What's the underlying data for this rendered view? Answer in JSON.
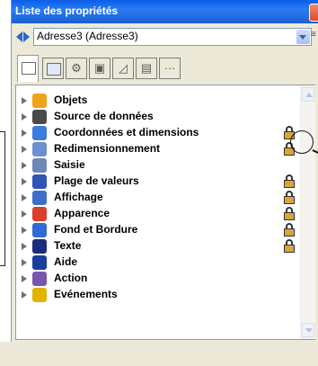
{
  "window": {
    "title": "Liste des propriétés"
  },
  "selector": {
    "value": "Adresse3 (Adresse3)"
  },
  "tabs": [
    {
      "name": "tab-list-icon"
    },
    {
      "name": "tab-form-icon"
    },
    {
      "name": "tab-gear-icon"
    },
    {
      "name": "tab-layout-icon"
    },
    {
      "name": "tab-chart-icon"
    },
    {
      "name": "tab-screen-icon"
    },
    {
      "name": "tab-more-icon"
    }
  ],
  "properties": [
    {
      "label": "Objets",
      "icon": "cube-icon",
      "color": "#f0a21a",
      "locked": false
    },
    {
      "label": "Source de données",
      "icon": "database-icon",
      "color": "#4a4a4a",
      "locked": false
    },
    {
      "label": "Coordonnées et dimensions",
      "icon": "move-icon",
      "color": "#3b7be0",
      "locked": true
    },
    {
      "label": "Redimensionnement",
      "icon": "resize-icon",
      "color": "#6b8fd0",
      "locked": true
    },
    {
      "label": "Saisie",
      "icon": "keyboard-icon",
      "color": "#6c88b5",
      "locked": false
    },
    {
      "label": "Plage de valeurs",
      "icon": "range-icon",
      "color": "#2d55b3",
      "locked": true
    },
    {
      "label": "Affichage",
      "icon": "display-icon",
      "color": "#3d6fc9",
      "locked": true
    },
    {
      "label": "Apparence",
      "icon": "eye-icon",
      "color": "#d8402a",
      "locked": true
    },
    {
      "label": "Fond et Bordure",
      "icon": "border-icon",
      "color": "#2f6bd6",
      "locked": true
    },
    {
      "label": "Texte",
      "icon": "text-icon",
      "color": "#1b2d7a",
      "locked": true
    },
    {
      "label": "Aide",
      "icon": "help-icon",
      "color": "#1a3f9a",
      "locked": false
    },
    {
      "label": "Action",
      "icon": "action-icon",
      "color": "#7a55b0",
      "locked": false
    },
    {
      "label": "Evénements",
      "icon": "events-icon",
      "color": "#e2b300",
      "locked": false
    }
  ]
}
